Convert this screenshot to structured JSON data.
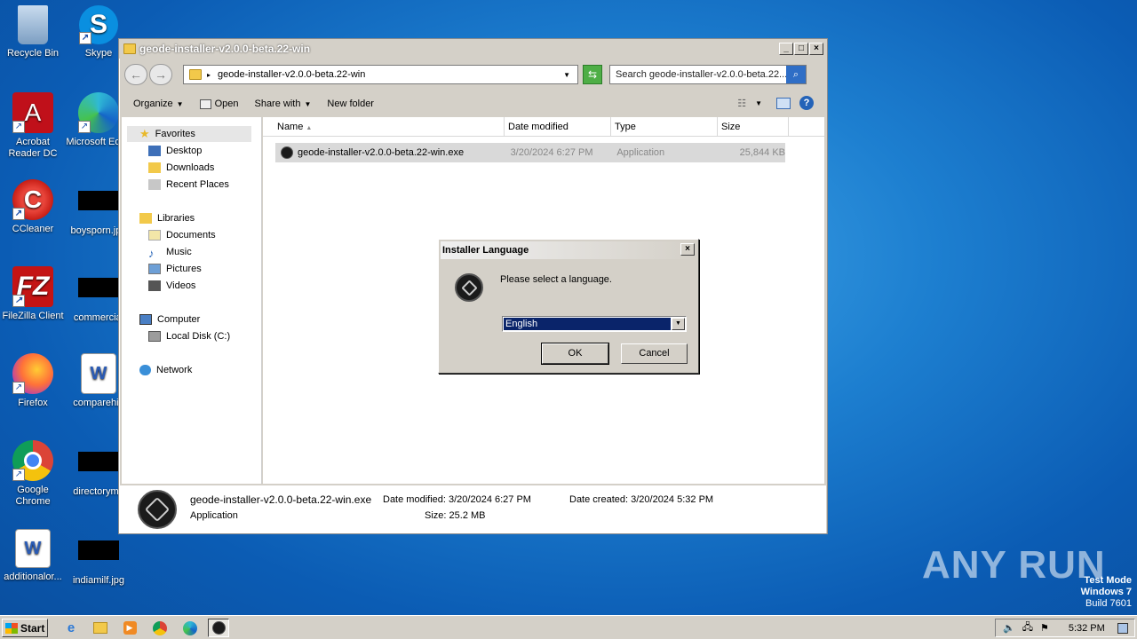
{
  "desktop": {
    "icons": [
      {
        "label": "Recycle Bin",
        "icon": "recycle-bin-icon"
      },
      {
        "label": "Skype",
        "icon": "skype-icon"
      },
      {
        "label": "Acrobat Reader DC",
        "icon": "acrobat-icon"
      },
      {
        "label": "Microsoft Edge",
        "icon": "edge-icon"
      },
      {
        "label": "CCleaner",
        "icon": "ccleaner-icon"
      },
      {
        "label": "boysporn.jpg",
        "icon": "image-file-icon"
      },
      {
        "label": "FileZilla Client",
        "icon": "filezilla-icon"
      },
      {
        "label": "commercial",
        "icon": "image-file-icon"
      },
      {
        "label": "Firefox",
        "icon": "firefox-icon"
      },
      {
        "label": "comparehig",
        "icon": "word-doc-icon"
      },
      {
        "label": "Google Chrome",
        "icon": "chrome-icon"
      },
      {
        "label": "directoryme",
        "icon": "image-file-icon"
      },
      {
        "label": "additionalor...",
        "icon": "word-doc-icon"
      },
      {
        "label": "indiamilf.jpg",
        "icon": "image-file-icon"
      }
    ],
    "watermark": "ANY RUN",
    "test_mode": [
      "Test Mode",
      "Windows 7",
      "Build 7601"
    ]
  },
  "explorer": {
    "title": "geode-installer-v2.0.0-beta.22-win",
    "address": "geode-installer-v2.0.0-beta.22-win",
    "search_placeholder": "Search geode-installer-v2.0.0-beta.22...",
    "toolbar": {
      "organize": "Organize",
      "open": "Open",
      "share_with": "Share with",
      "new_folder": "New folder"
    },
    "nav": {
      "favorites": "Favorites",
      "desktop": "Desktop",
      "downloads": "Downloads",
      "recent_places": "Recent Places",
      "libraries": "Libraries",
      "documents": "Documents",
      "music": "Music",
      "pictures": "Pictures",
      "videos": "Videos",
      "computer": "Computer",
      "local_disk": "Local Disk (C:)",
      "network": "Network"
    },
    "columns": {
      "name": "Name",
      "date_modified": "Date modified",
      "type": "Type",
      "size": "Size"
    },
    "file": {
      "name": "geode-installer-v2.0.0-beta.22-win.exe",
      "date_modified": "3/20/2024 6:27 PM",
      "type": "Application",
      "size": "25,844 KB"
    },
    "details": {
      "name": "geode-installer-v2.0.0-beta.22-win.exe",
      "type": "Application",
      "date_modified_label": "Date modified:",
      "date_modified": "3/20/2024 6:27 PM",
      "size_label": "Size:",
      "size": "25.2 MB",
      "date_created_label": "Date created:",
      "date_created": "3/20/2024 5:32 PM"
    }
  },
  "dialog": {
    "title": "Installer Language",
    "message": "Please select a language.",
    "selected_language": "English",
    "ok": "OK",
    "cancel": "Cancel"
  },
  "taskbar": {
    "start": "Start",
    "clock": "5:32 PM"
  }
}
